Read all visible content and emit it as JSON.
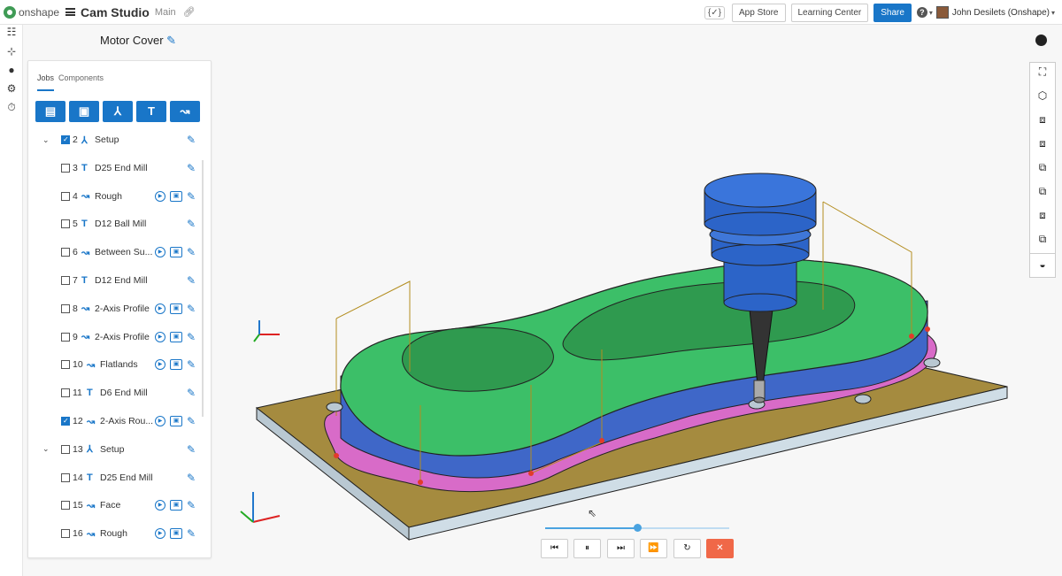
{
  "app": {
    "logo_text": "onshape",
    "doc_title": "Cam Studio",
    "branch": "Main",
    "part_title": "Motor Cover",
    "brand_color": "#1976c8"
  },
  "topbar": {
    "braces": "{✓}",
    "app_store": "App Store",
    "learning_center": "Learning Center",
    "share": "Share",
    "help": "?",
    "user_name": "John Desilets (Onshape)"
  },
  "panel": {
    "tabs": [
      "Jobs",
      "Components"
    ],
    "toolbar_icons": [
      "folder-icon",
      "save-icon",
      "setup-icon",
      "tool-icon",
      "toolpath-icon"
    ],
    "rows": [
      {
        "num": "2",
        "label": "Setup",
        "type": "setup",
        "checked": true,
        "chevron": true
      },
      {
        "num": "3",
        "label": "D25 End Mill",
        "type": "tool",
        "checked": false
      },
      {
        "num": "4",
        "label": "Rough",
        "type": "toolpath",
        "checked": false,
        "sim": true
      },
      {
        "num": "5",
        "label": "D12 Ball Mill",
        "type": "tool",
        "checked": false
      },
      {
        "num": "6",
        "label": "Between Su...",
        "type": "toolpath",
        "checked": false,
        "sim": true
      },
      {
        "num": "7",
        "label": "D12 End Mill",
        "type": "tool",
        "checked": false
      },
      {
        "num": "8",
        "label": "2-Axis Profile",
        "type": "toolpath",
        "checked": false,
        "sim": true
      },
      {
        "num": "9",
        "label": "2-Axis Profile",
        "type": "toolpath",
        "checked": false,
        "sim": true
      },
      {
        "num": "10",
        "label": "Flatlands",
        "type": "toolpath",
        "checked": false,
        "sim": true
      },
      {
        "num": "11",
        "label": "D6 End Mill",
        "type": "tool",
        "checked": false
      },
      {
        "num": "12",
        "label": "2-Axis Rou...",
        "type": "toolpath",
        "checked": true,
        "sim": true
      },
      {
        "num": "13",
        "label": "Setup",
        "type": "setup",
        "checked": false,
        "chevron": true
      },
      {
        "num": "14",
        "label": "D25 End Mill",
        "type": "tool",
        "checked": false
      },
      {
        "num": "15",
        "label": "Face",
        "type": "toolpath",
        "checked": false,
        "sim": true
      },
      {
        "num": "16",
        "label": "Rough",
        "type": "toolpath",
        "checked": false,
        "sim": true
      }
    ]
  },
  "view_cube": [
    "fit-icon",
    "iso-view-icon",
    "front-view-icon",
    "top-view-icon",
    "right-view-icon",
    "back-view-icon",
    "left-view-icon",
    "bottom-view-icon",
    "section-icon"
  ],
  "playback": {
    "progress": 0.5,
    "buttons": [
      "step-back",
      "pause",
      "step-forward",
      "fast-forward",
      "restart",
      "stop"
    ]
  }
}
